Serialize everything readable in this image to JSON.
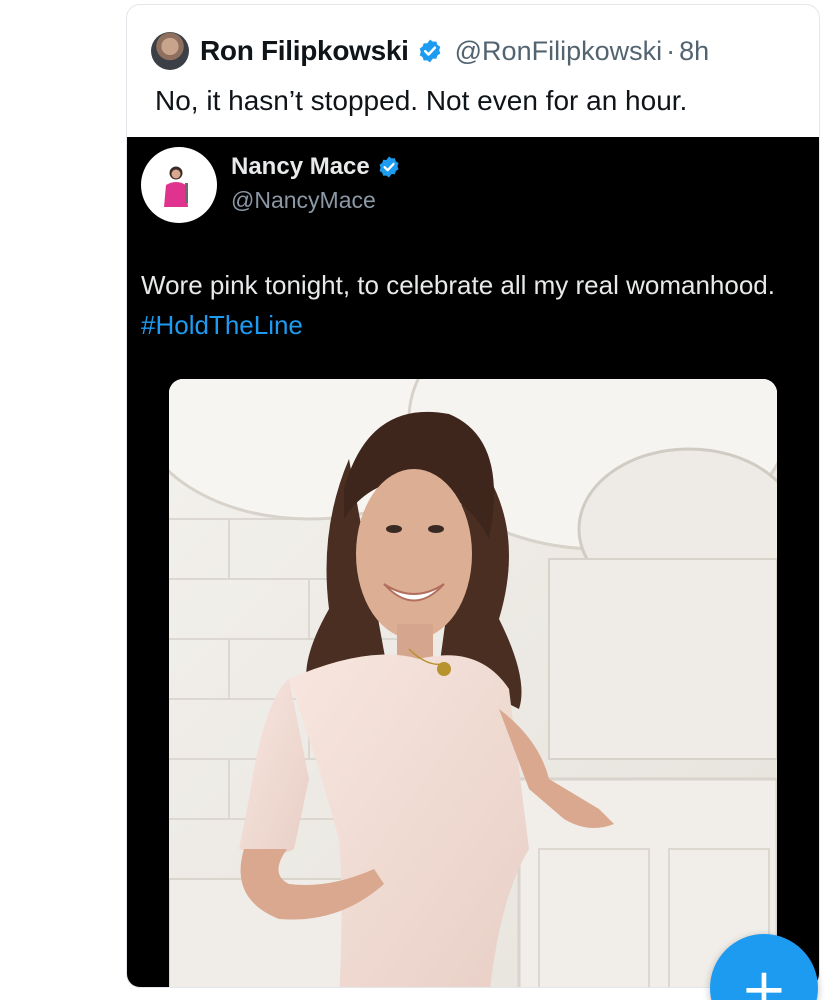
{
  "outer_tweet": {
    "author_name": "Ron Filipkowski",
    "handle": "@RonFilipkowski",
    "separator": "·",
    "time": "8h",
    "text": "No, it hasn’t stopped. Not even for an hour.",
    "verified_color": "#1d9bf0"
  },
  "quoted_tweet": {
    "author_name": "Nancy Mace",
    "handle": "@NancyMace",
    "text": "Wore pink tonight, to celebrate all my real womanhood.",
    "hashtag": "#HoldTheLine",
    "hashtag_color": "#1d9bf0",
    "background": "#000000"
  },
  "fab": {
    "icon": "plus-icon",
    "label": "+",
    "color": "#1d9bf0"
  }
}
